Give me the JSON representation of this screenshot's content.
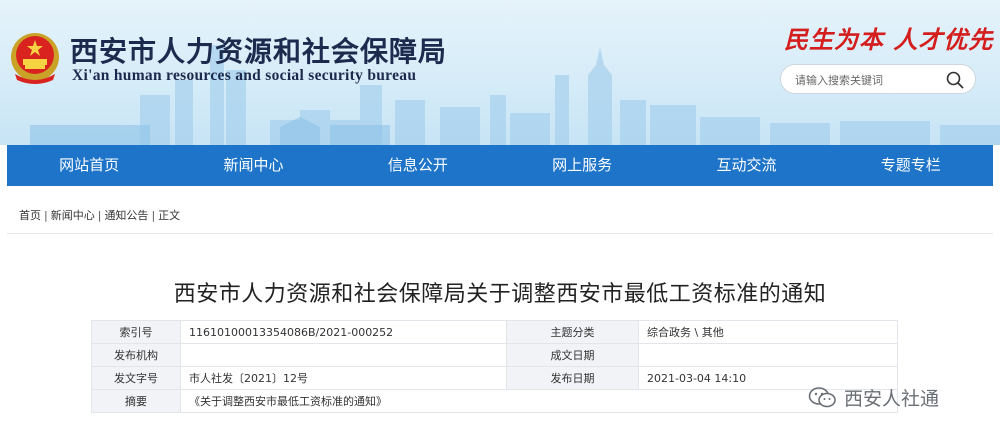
{
  "header": {
    "site_title": "西安市人力资源和社会保障局",
    "site_subtitle": "Xi'an human resources and social security bureau",
    "slogan": "民生为本 人才优先"
  },
  "search": {
    "placeholder": "请输入搜索关键词",
    "button_icon": "search-icon"
  },
  "nav": {
    "items": [
      {
        "label": "网站首页"
      },
      {
        "label": "新闻中心"
      },
      {
        "label": "信息公开"
      },
      {
        "label": "网上服务"
      },
      {
        "label": "互动交流"
      },
      {
        "label": "专题专栏"
      }
    ]
  },
  "breadcrumb": {
    "items": [
      "首页",
      "新闻中心",
      "通知公告",
      "正文"
    ],
    "separator": "|"
  },
  "article": {
    "title": "西安市人力资源和社会保障局关于调整西安市最低工资标准的通知"
  },
  "info": {
    "index_label": "索引号",
    "index_value": "11610100013354086B/2021-000252",
    "category_label": "主题分类",
    "category_value": "综合政务 \\ 其他",
    "publisher_label": "发布机构",
    "publisher_value": "",
    "created_label": "成文日期",
    "created_value": "",
    "doc_no_label": "发文字号",
    "doc_no_value": "市人社发〔2021〕12号",
    "publish_date_label": "发布日期",
    "publish_date_value": "2021-03-04 14:10",
    "abstract_label": "摘要",
    "abstract_value": "《关于调整西安市最低工资标准的通知》"
  },
  "watermark": {
    "text": "西安人社通",
    "icon": "wechat-icon"
  },
  "colors": {
    "nav_bg": "#1d74c8",
    "slogan": "#d41e1e",
    "title": "#1c2a4d"
  }
}
